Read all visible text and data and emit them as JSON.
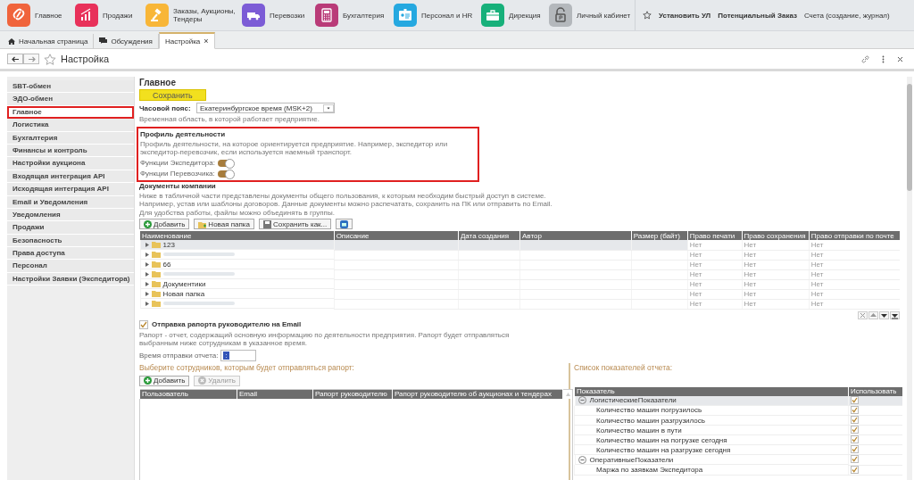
{
  "app_sections": [
    {
      "label": "Главное",
      "color": "#f0643c"
    },
    {
      "label": "Продажи",
      "color": "#e8315a"
    },
    {
      "label": "Заказы, Аукционы, Тендеры",
      "color": "#f8b638"
    },
    {
      "label": "Перевозки",
      "color": "#7c5cd6"
    },
    {
      "label": "Бухгалтерия",
      "color": "#b93b78"
    },
    {
      "label": "Персонал и HR",
      "color": "#25a8e0"
    },
    {
      "label": "Дирекция",
      "color": "#17b07a"
    },
    {
      "label": "Личный кабинет",
      "color": "#b4b8bc"
    }
  ],
  "quick_links": [
    {
      "label": "Установить УЛ",
      "kind": "bold"
    },
    {
      "label": "Потенциальный Заказ",
      "kind": "bold"
    },
    {
      "label": "Счета (создание, журнал)",
      "kind": "plain"
    }
  ],
  "open_tabs": [
    {
      "label": "Начальная страница",
      "kind": "home",
      "selected": false,
      "closable": false
    },
    {
      "label": "Обсуждения",
      "kind": "discussion",
      "selected": false,
      "closable": false
    },
    {
      "label": "Настройка",
      "kind": "page",
      "selected": true,
      "closable": true
    }
  ],
  "close_tab_label": "×",
  "page_title": "Настройка",
  "sidebar": {
    "items": [
      {
        "label": "SBT-обмен",
        "selected": false
      },
      {
        "label": "ЭДО-обмен",
        "selected": false
      },
      {
        "label": "Главное",
        "selected": true
      },
      {
        "label": "Логистика",
        "selected": false
      },
      {
        "label": "Бухгалтерия",
        "selected": false
      },
      {
        "label": "Финансы и контроль",
        "selected": false
      },
      {
        "label": "Настройки аукциона",
        "selected": false
      },
      {
        "label": "Входящая интеграция API",
        "selected": false
      },
      {
        "label": "Исходящая интеграция API",
        "selected": false
      },
      {
        "label": "Email и Уведомления",
        "selected": false
      },
      {
        "label": "Уведомления",
        "selected": false
      },
      {
        "label": "Продажи",
        "selected": false
      },
      {
        "label": "Безопасность",
        "selected": false
      },
      {
        "label": "Права доступа",
        "selected": false
      },
      {
        "label": "Персонал",
        "selected": false
      },
      {
        "label": "Настройки Заявки (Экспедитора)",
        "selected": false
      }
    ]
  },
  "main": {
    "heading": "Главное",
    "save_button": "Сохранить",
    "timezone": {
      "label": "Часовой пояс:",
      "value": "Екатеринбургское время (MSK+2)",
      "hint": "Временная область, в которой работает предприятие."
    },
    "profile": {
      "highlighted": true,
      "title": "Профиль деятельности",
      "description": "Профиль деятельности, на которое ориентируется предприятие. Например, экспедитор или экспедитор-перевозчик, если используется наемный транспорт.",
      "toggles": [
        {
          "label": "Функции Экспедитора:",
          "on": true
        },
        {
          "label": "Функции Перевозчика:",
          "on": true
        }
      ]
    },
    "documents": {
      "title": "Документы компании",
      "description": "Ниже в табличной части представлены документы общего пользования, к которым необходим быстрый доступ в системе. Например, устав или шаблоны договоров. Данные документы можно распечатать, сохранить на ПК или отправить по Email. Для удобства работы, файлы можно объединять в группы.",
      "buttons": [
        {
          "label": "Добавить",
          "kind": "add"
        },
        {
          "label": "Новая папка",
          "kind": "folder"
        },
        {
          "label": "Сохранить как...",
          "kind": "save"
        },
        {
          "kind": "mail"
        }
      ],
      "columns": [
        "Наименование",
        "Описание",
        "Дата создания",
        "Автор",
        "Размер (байт)",
        "Право печати",
        "Право сохранения",
        "Право отправки по почте"
      ],
      "rows": [
        {
          "name": "123",
          "blurred": false,
          "selected": true,
          "rights": [
            "Нет",
            "Нет",
            "Нет"
          ]
        },
        {
          "blurred": true,
          "selected": false,
          "rights": [
            "Нет",
            "Нет",
            "Нет"
          ]
        },
        {
          "name": "66",
          "blurred": false,
          "selected": false,
          "rights": [
            "Нет",
            "Нет",
            "Нет"
          ]
        },
        {
          "blurred": true,
          "selected": false,
          "rights": [
            "Нет",
            "Нет",
            "Нет"
          ]
        },
        {
          "name": "Документики",
          "blurred": false,
          "selected": false,
          "rights": [
            "Нет",
            "Нет",
            "Нет"
          ]
        },
        {
          "name": "Новая папка",
          "blurred": false,
          "selected": false,
          "rights": [
            "Нет",
            "Нет",
            "Нет"
          ]
        },
        {
          "blurred": true,
          "selected": false,
          "rights": [
            "Нет",
            "Нет",
            "Нет"
          ]
        }
      ]
    },
    "report": {
      "checked": true,
      "title": "Отправка рапорта руководителю на Email",
      "description": "Рапорт - отчет, содержащий основную информацию по деятельности предприятия. Рапорт будет отправляться выбранным ниже сотрудникам в указанное время.",
      "time_label": "Время отправки отчета:",
      "time_value": ":",
      "employees": {
        "title": "Выберите сотрудников, которым будет отправляться рапорт:",
        "buttons": [
          {
            "label": "Добавить",
            "kind": "add",
            "disabled": false
          },
          {
            "label": "Удалить",
            "kind": "delete",
            "disabled": true
          }
        ],
        "columns": [
          "Пользователь",
          "Email",
          "Рапорт руководителю",
          "Рапорт руководителю об аукционах и тендерах"
        ]
      },
      "indicators": {
        "title": "Список показателей отчета:",
        "columns": [
          "Показатель",
          "Использовать"
        ],
        "groups": [
          {
            "label": "ЛогистическиеПоказатели",
            "expanded": true,
            "checked": true,
            "selected": true,
            "children": [
              {
                "label": "Количество машин погрузилось",
                "checked": true
              },
              {
                "label": "Количество машин разгрузилось",
                "checked": true
              },
              {
                "label": "Количество машин в пути",
                "checked": true
              },
              {
                "label": "Количество машин на погрузке сегодня",
                "checked": true
              },
              {
                "label": "Количество машин на разгрузке сегодня",
                "checked": true
              }
            ]
          },
          {
            "label": "ОперативныеПоказатели",
            "expanded": true,
            "checked": true,
            "selected": false,
            "children": [
              {
                "label": "Маржа по заявкам Экспедитора",
                "checked": true
              }
            ]
          }
        ]
      }
    }
  }
}
